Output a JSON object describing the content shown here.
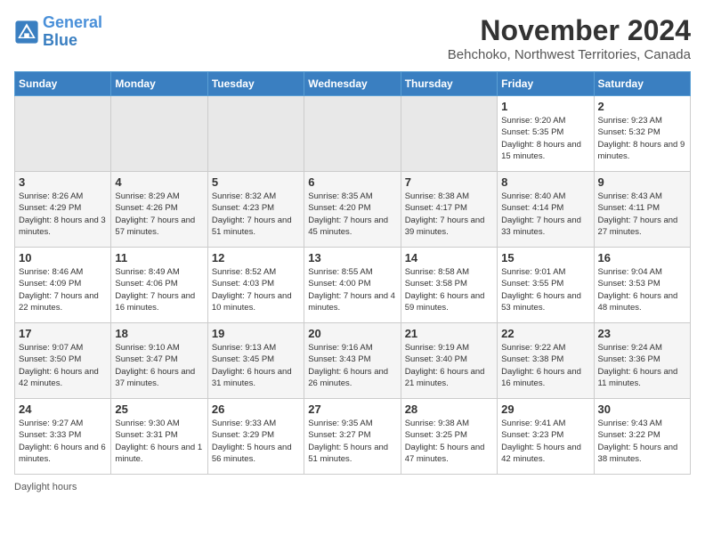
{
  "header": {
    "logo_line1": "General",
    "logo_line2": "Blue",
    "month_title": "November 2024",
    "subtitle": "Behchoko, Northwest Territories, Canada"
  },
  "days_of_week": [
    "Sunday",
    "Monday",
    "Tuesday",
    "Wednesday",
    "Thursday",
    "Friday",
    "Saturday"
  ],
  "weeks": [
    [
      {
        "day": "",
        "info": ""
      },
      {
        "day": "",
        "info": ""
      },
      {
        "day": "",
        "info": ""
      },
      {
        "day": "",
        "info": ""
      },
      {
        "day": "",
        "info": ""
      },
      {
        "day": "1",
        "info": "Sunrise: 9:20 AM\nSunset: 5:35 PM\nDaylight: 8 hours and 15 minutes."
      },
      {
        "day": "2",
        "info": "Sunrise: 9:23 AM\nSunset: 5:32 PM\nDaylight: 8 hours and 9 minutes."
      }
    ],
    [
      {
        "day": "3",
        "info": "Sunrise: 8:26 AM\nSunset: 4:29 PM\nDaylight: 8 hours and 3 minutes."
      },
      {
        "day": "4",
        "info": "Sunrise: 8:29 AM\nSunset: 4:26 PM\nDaylight: 7 hours and 57 minutes."
      },
      {
        "day": "5",
        "info": "Sunrise: 8:32 AM\nSunset: 4:23 PM\nDaylight: 7 hours and 51 minutes."
      },
      {
        "day": "6",
        "info": "Sunrise: 8:35 AM\nSunset: 4:20 PM\nDaylight: 7 hours and 45 minutes."
      },
      {
        "day": "7",
        "info": "Sunrise: 8:38 AM\nSunset: 4:17 PM\nDaylight: 7 hours and 39 minutes."
      },
      {
        "day": "8",
        "info": "Sunrise: 8:40 AM\nSunset: 4:14 PM\nDaylight: 7 hours and 33 minutes."
      },
      {
        "day": "9",
        "info": "Sunrise: 8:43 AM\nSunset: 4:11 PM\nDaylight: 7 hours and 27 minutes."
      }
    ],
    [
      {
        "day": "10",
        "info": "Sunrise: 8:46 AM\nSunset: 4:09 PM\nDaylight: 7 hours and 22 minutes."
      },
      {
        "day": "11",
        "info": "Sunrise: 8:49 AM\nSunset: 4:06 PM\nDaylight: 7 hours and 16 minutes."
      },
      {
        "day": "12",
        "info": "Sunrise: 8:52 AM\nSunset: 4:03 PM\nDaylight: 7 hours and 10 minutes."
      },
      {
        "day": "13",
        "info": "Sunrise: 8:55 AM\nSunset: 4:00 PM\nDaylight: 7 hours and 4 minutes."
      },
      {
        "day": "14",
        "info": "Sunrise: 8:58 AM\nSunset: 3:58 PM\nDaylight: 6 hours and 59 minutes."
      },
      {
        "day": "15",
        "info": "Sunrise: 9:01 AM\nSunset: 3:55 PM\nDaylight: 6 hours and 53 minutes."
      },
      {
        "day": "16",
        "info": "Sunrise: 9:04 AM\nSunset: 3:53 PM\nDaylight: 6 hours and 48 minutes."
      }
    ],
    [
      {
        "day": "17",
        "info": "Sunrise: 9:07 AM\nSunset: 3:50 PM\nDaylight: 6 hours and 42 minutes."
      },
      {
        "day": "18",
        "info": "Sunrise: 9:10 AM\nSunset: 3:47 PM\nDaylight: 6 hours and 37 minutes."
      },
      {
        "day": "19",
        "info": "Sunrise: 9:13 AM\nSunset: 3:45 PM\nDaylight: 6 hours and 31 minutes."
      },
      {
        "day": "20",
        "info": "Sunrise: 9:16 AM\nSunset: 3:43 PM\nDaylight: 6 hours and 26 minutes."
      },
      {
        "day": "21",
        "info": "Sunrise: 9:19 AM\nSunset: 3:40 PM\nDaylight: 6 hours and 21 minutes."
      },
      {
        "day": "22",
        "info": "Sunrise: 9:22 AM\nSunset: 3:38 PM\nDaylight: 6 hours and 16 minutes."
      },
      {
        "day": "23",
        "info": "Sunrise: 9:24 AM\nSunset: 3:36 PM\nDaylight: 6 hours and 11 minutes."
      }
    ],
    [
      {
        "day": "24",
        "info": "Sunrise: 9:27 AM\nSunset: 3:33 PM\nDaylight: 6 hours and 6 minutes."
      },
      {
        "day": "25",
        "info": "Sunrise: 9:30 AM\nSunset: 3:31 PM\nDaylight: 6 hours and 1 minute."
      },
      {
        "day": "26",
        "info": "Sunrise: 9:33 AM\nSunset: 3:29 PM\nDaylight: 5 hours and 56 minutes."
      },
      {
        "day": "27",
        "info": "Sunrise: 9:35 AM\nSunset: 3:27 PM\nDaylight: 5 hours and 51 minutes."
      },
      {
        "day": "28",
        "info": "Sunrise: 9:38 AM\nSunset: 3:25 PM\nDaylight: 5 hours and 47 minutes."
      },
      {
        "day": "29",
        "info": "Sunrise: 9:41 AM\nSunset: 3:23 PM\nDaylight: 5 hours and 42 minutes."
      },
      {
        "day": "30",
        "info": "Sunrise: 9:43 AM\nSunset: 3:22 PM\nDaylight: 5 hours and 38 minutes."
      }
    ]
  ],
  "legend": {
    "daylight_hours": "Daylight hours"
  }
}
